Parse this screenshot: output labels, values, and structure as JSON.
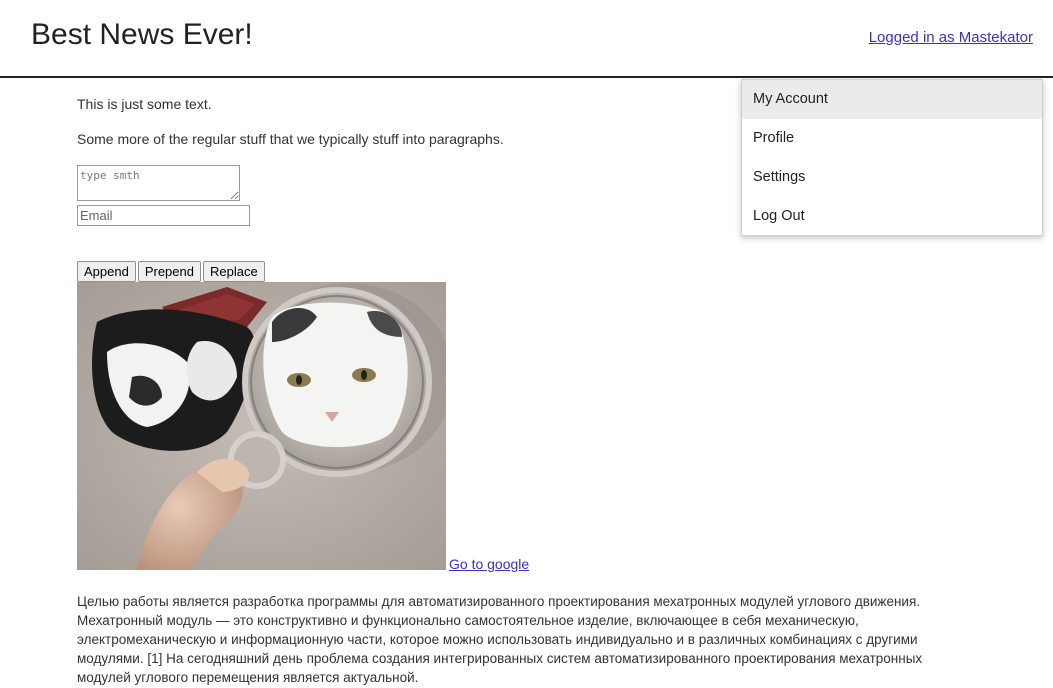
{
  "header": {
    "site_title": "Best News Ever!",
    "user_link": "Logged in as Mastekator"
  },
  "main": {
    "paragraph_1": "This is just some text.",
    "paragraph_2": "Some more of the regular stuff that we typically stuff into paragraphs.",
    "textarea_placeholder": "type smth",
    "email_placeholder": "Email",
    "buttons": {
      "append": "Append",
      "prepend": "Prepend",
      "replace": "Replace"
    },
    "google_link": "Go to google",
    "article_text": "Целью работы является разработка программы для автоматизированного проектирования мехатронных модулей углового движения. Мехатронный модуль — это конструктивно и функционально самостоятельное изделие, включающее в себя механическую, электромеханическую и информационную части, которое можно использовать индивидуально и в различных комбинациях с другими модулями. [1] На сегодняшний день проблема создания интегрированных систем автоматизированного проектирования мехатронных модулей углового перемещения является актуальной."
  },
  "dropdown": {
    "items": [
      {
        "label": "My Account"
      },
      {
        "label": "Profile"
      },
      {
        "label": "Settings"
      },
      {
        "label": "Log Out"
      }
    ]
  },
  "colors": {
    "link": "#3b2fd6",
    "header_border": "#222222",
    "menu_active_bg": "#ebebeb"
  }
}
